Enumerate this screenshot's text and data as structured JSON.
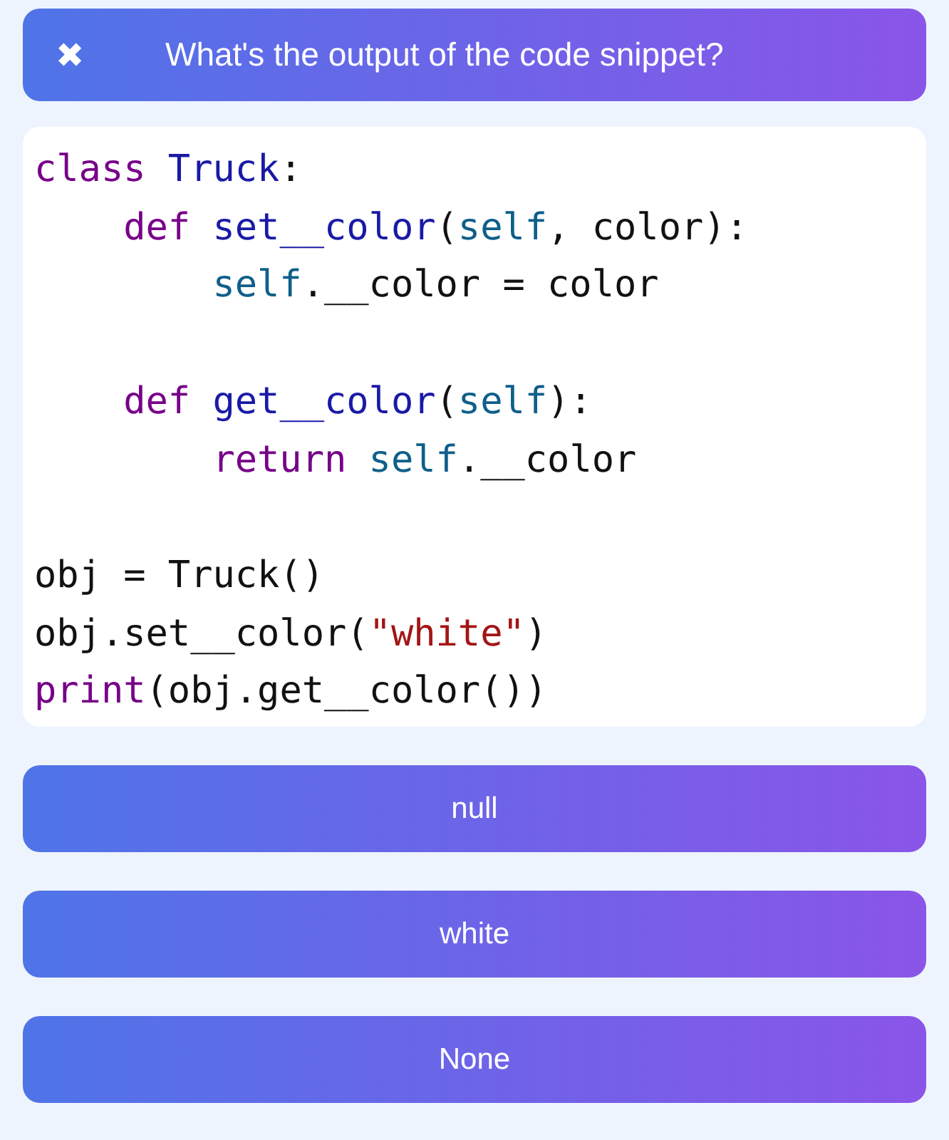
{
  "header": {
    "close_icon": "✖",
    "title": "What's the output of the code snippet?"
  },
  "code": {
    "blocks": [
      [
        {
          "tokens": [
            {
              "text": "class",
              "kind": "keyword"
            },
            {
              "text": " Truck",
              "kind": "name"
            },
            {
              "text": ":",
              "kind": "plain"
            }
          ]
        },
        {
          "tokens": [
            {
              "text": "    def",
              "kind": "keyword"
            },
            {
              "text": " set__color",
              "kind": "name"
            },
            {
              "text": "(",
              "kind": "plain"
            },
            {
              "text": "self",
              "kind": "self"
            },
            {
              "text": ", color):",
              "kind": "plain"
            }
          ]
        },
        {
          "tokens": [
            {
              "text": "        self",
              "kind": "self"
            },
            {
              "text": ".__color = color",
              "kind": "plain"
            }
          ]
        }
      ],
      [
        {
          "tokens": [
            {
              "text": "    def",
              "kind": "keyword"
            },
            {
              "text": " get__color",
              "kind": "name"
            },
            {
              "text": "(",
              "kind": "plain"
            },
            {
              "text": "self",
              "kind": "self"
            },
            {
              "text": "):",
              "kind": "plain"
            }
          ]
        },
        {
          "tokens": [
            {
              "text": "        return",
              "kind": "keyword"
            },
            {
              "text": " self",
              "kind": "self"
            },
            {
              "text": ".__color",
              "kind": "plain"
            }
          ]
        }
      ],
      [
        {
          "tokens": [
            {
              "text": "obj = Truck()",
              "kind": "plain"
            }
          ]
        },
        {
          "tokens": [
            {
              "text": "obj.set__color(",
              "kind": "plain"
            },
            {
              "text": "\"white\"",
              "kind": "string"
            },
            {
              "text": ")",
              "kind": "plain"
            }
          ]
        },
        {
          "tokens": [
            {
              "text": "print",
              "kind": "keyword"
            },
            {
              "text": "(obj.get__color())",
              "kind": "plain"
            }
          ]
        }
      ]
    ]
  },
  "answers": [
    "null",
    "white",
    "None"
  ]
}
